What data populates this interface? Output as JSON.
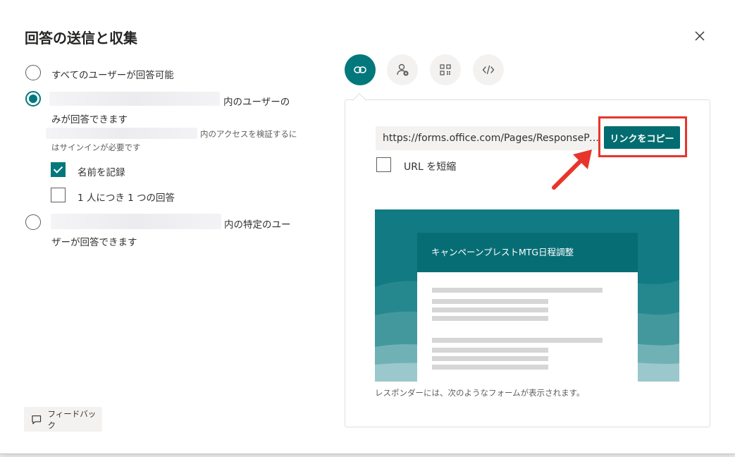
{
  "dialog": {
    "title": "回答の送信と収集",
    "close_icon": "close-icon"
  },
  "options": {
    "anyone": {
      "label": "すべてのユーザーが回答可能",
      "checked": false
    },
    "org_only": {
      "label_line1": "内のユーザーの",
      "label_line2": "みが回答できます",
      "note_line1": "内のアクセスを検証するに",
      "note_line2": "はサインインが必要です",
      "checked": true
    },
    "record_name": {
      "label": "名前を記録",
      "checked": true
    },
    "one_response": {
      "label": "1 人につき 1 つの回答",
      "checked": false
    },
    "specific": {
      "label_line1": "内の特定のユー",
      "label_line2": "ザーが回答できます",
      "checked": false
    }
  },
  "feedback": {
    "label": "フィードバック",
    "icon": "comment-icon"
  },
  "tabs": [
    {
      "name": "link",
      "icon": "link-icon",
      "active": true
    },
    {
      "name": "invite",
      "icon": "person-add-icon",
      "active": false
    },
    {
      "name": "qr",
      "icon": "qr-code-icon",
      "active": false
    },
    {
      "name": "embed",
      "icon": "code-icon",
      "active": false
    }
  ],
  "share": {
    "url": "https://forms.office.com/Pages/ResponsePage.aspx",
    "copy_label": "リンクをコピー",
    "shorten_label": "URL を短縮",
    "shorten_checked": false
  },
  "preview": {
    "form_title": "キャンペーンプレストMTG日程調整",
    "caption": "レスポンダーには、次のようなフォームが表示されます。"
  },
  "colors": {
    "accent": "#03787c",
    "button": "#036c70",
    "highlight": "#e8352b"
  }
}
